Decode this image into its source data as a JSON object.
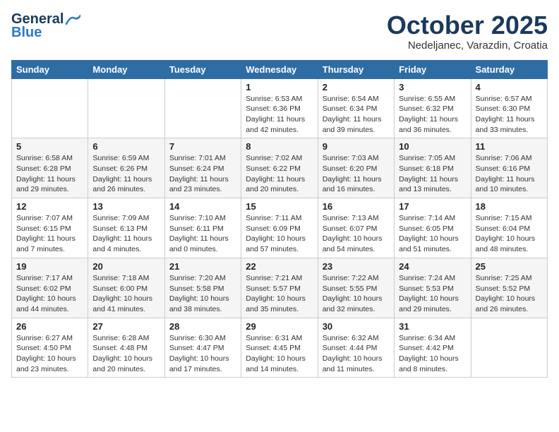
{
  "header": {
    "logo_line1": "General",
    "logo_line2": "Blue",
    "month": "October 2025",
    "location": "Nedeljanec, Varazdin, Croatia"
  },
  "weekdays": [
    "Sunday",
    "Monday",
    "Tuesday",
    "Wednesday",
    "Thursday",
    "Friday",
    "Saturday"
  ],
  "weeks": [
    [
      {
        "day": "",
        "info": ""
      },
      {
        "day": "",
        "info": ""
      },
      {
        "day": "",
        "info": ""
      },
      {
        "day": "1",
        "info": "Sunrise: 6:53 AM\nSunset: 6:36 PM\nDaylight: 11 hours\nand 42 minutes."
      },
      {
        "day": "2",
        "info": "Sunrise: 6:54 AM\nSunset: 6:34 PM\nDaylight: 11 hours\nand 39 minutes."
      },
      {
        "day": "3",
        "info": "Sunrise: 6:55 AM\nSunset: 6:32 PM\nDaylight: 11 hours\nand 36 minutes."
      },
      {
        "day": "4",
        "info": "Sunrise: 6:57 AM\nSunset: 6:30 PM\nDaylight: 11 hours\nand 33 minutes."
      }
    ],
    [
      {
        "day": "5",
        "info": "Sunrise: 6:58 AM\nSunset: 6:28 PM\nDaylight: 11 hours\nand 29 minutes."
      },
      {
        "day": "6",
        "info": "Sunrise: 6:59 AM\nSunset: 6:26 PM\nDaylight: 11 hours\nand 26 minutes."
      },
      {
        "day": "7",
        "info": "Sunrise: 7:01 AM\nSunset: 6:24 PM\nDaylight: 11 hours\nand 23 minutes."
      },
      {
        "day": "8",
        "info": "Sunrise: 7:02 AM\nSunset: 6:22 PM\nDaylight: 11 hours\nand 20 minutes."
      },
      {
        "day": "9",
        "info": "Sunrise: 7:03 AM\nSunset: 6:20 PM\nDaylight: 11 hours\nand 16 minutes."
      },
      {
        "day": "10",
        "info": "Sunrise: 7:05 AM\nSunset: 6:18 PM\nDaylight: 11 hours\nand 13 minutes."
      },
      {
        "day": "11",
        "info": "Sunrise: 7:06 AM\nSunset: 6:16 PM\nDaylight: 11 hours\nand 10 minutes."
      }
    ],
    [
      {
        "day": "12",
        "info": "Sunrise: 7:07 AM\nSunset: 6:15 PM\nDaylight: 11 hours\nand 7 minutes."
      },
      {
        "day": "13",
        "info": "Sunrise: 7:09 AM\nSunset: 6:13 PM\nDaylight: 11 hours\nand 4 minutes."
      },
      {
        "day": "14",
        "info": "Sunrise: 7:10 AM\nSunset: 6:11 PM\nDaylight: 11 hours\nand 0 minutes."
      },
      {
        "day": "15",
        "info": "Sunrise: 7:11 AM\nSunset: 6:09 PM\nDaylight: 10 hours\nand 57 minutes."
      },
      {
        "day": "16",
        "info": "Sunrise: 7:13 AM\nSunset: 6:07 PM\nDaylight: 10 hours\nand 54 minutes."
      },
      {
        "day": "17",
        "info": "Sunrise: 7:14 AM\nSunset: 6:05 PM\nDaylight: 10 hours\nand 51 minutes."
      },
      {
        "day": "18",
        "info": "Sunrise: 7:15 AM\nSunset: 6:04 PM\nDaylight: 10 hours\nand 48 minutes."
      }
    ],
    [
      {
        "day": "19",
        "info": "Sunrise: 7:17 AM\nSunset: 6:02 PM\nDaylight: 10 hours\nand 44 minutes."
      },
      {
        "day": "20",
        "info": "Sunrise: 7:18 AM\nSunset: 6:00 PM\nDaylight: 10 hours\nand 41 minutes."
      },
      {
        "day": "21",
        "info": "Sunrise: 7:20 AM\nSunset: 5:58 PM\nDaylight: 10 hours\nand 38 minutes."
      },
      {
        "day": "22",
        "info": "Sunrise: 7:21 AM\nSunset: 5:57 PM\nDaylight: 10 hours\nand 35 minutes."
      },
      {
        "day": "23",
        "info": "Sunrise: 7:22 AM\nSunset: 5:55 PM\nDaylight: 10 hours\nand 32 minutes."
      },
      {
        "day": "24",
        "info": "Sunrise: 7:24 AM\nSunset: 5:53 PM\nDaylight: 10 hours\nand 29 minutes."
      },
      {
        "day": "25",
        "info": "Sunrise: 7:25 AM\nSunset: 5:52 PM\nDaylight: 10 hours\nand 26 minutes."
      }
    ],
    [
      {
        "day": "26",
        "info": "Sunrise: 6:27 AM\nSunset: 4:50 PM\nDaylight: 10 hours\nand 23 minutes."
      },
      {
        "day": "27",
        "info": "Sunrise: 6:28 AM\nSunset: 4:48 PM\nDaylight: 10 hours\nand 20 minutes."
      },
      {
        "day": "28",
        "info": "Sunrise: 6:30 AM\nSunset: 4:47 PM\nDaylight: 10 hours\nand 17 minutes."
      },
      {
        "day": "29",
        "info": "Sunrise: 6:31 AM\nSunset: 4:45 PM\nDaylight: 10 hours\nand 14 minutes."
      },
      {
        "day": "30",
        "info": "Sunrise: 6:32 AM\nSunset: 4:44 PM\nDaylight: 10 hours\nand 11 minutes."
      },
      {
        "day": "31",
        "info": "Sunrise: 6:34 AM\nSunset: 4:42 PM\nDaylight: 10 hours\nand 8 minutes."
      },
      {
        "day": "",
        "info": ""
      }
    ]
  ]
}
